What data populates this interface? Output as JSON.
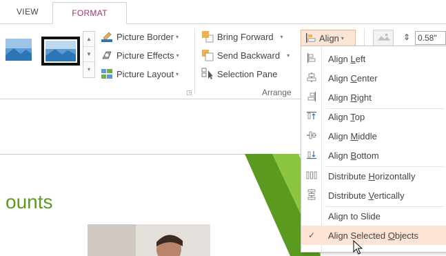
{
  "tabs": {
    "view": "VIEW",
    "format": "FORMAT"
  },
  "ribbon": {
    "picture_styles": {
      "picture_border": "Picture Border",
      "picture_effects": "Picture Effects",
      "picture_layout": "Picture Layout"
    },
    "arrange": {
      "bring_forward": "Bring Forward",
      "send_backward": "Send Backward",
      "selection_pane": "Selection Pane",
      "group_label": "Arrange",
      "align_button": "Align"
    },
    "size": {
      "height_value": "0.58\""
    }
  },
  "align_menu": {
    "items": [
      {
        "pre": "Align ",
        "key": "L",
        "post": "eft",
        "icon": "align-left-icon"
      },
      {
        "pre": "Align ",
        "key": "C",
        "post": "enter",
        "icon": "align-center-icon"
      },
      {
        "pre": "Align ",
        "key": "R",
        "post": "ight",
        "icon": "align-right-icon"
      },
      {
        "pre": "Align ",
        "key": "T",
        "post": "op",
        "icon": "align-top-icon"
      },
      {
        "pre": "Align ",
        "key": "M",
        "post": "iddle",
        "icon": "align-middle-icon"
      },
      {
        "pre": "Align ",
        "key": "B",
        "post": "ottom",
        "icon": "align-bottom-icon"
      },
      {
        "pre": "Distribute ",
        "key": "H",
        "post": "orizontally",
        "icon": "distribute-horizontal-icon"
      },
      {
        "pre": "Distribute ",
        "key": "V",
        "post": "ertically",
        "icon": "distribute-vertical-icon"
      },
      {
        "pre": "Align to Slide",
        "key": "",
        "post": "",
        "icon": ""
      },
      {
        "pre": "Align Selected ",
        "key": "O",
        "post": "bjects",
        "icon": "checkmark-icon"
      }
    ]
  },
  "slide": {
    "title_fragment": "ounts"
  },
  "colors": {
    "format_tab": "#a2306f",
    "accent_green": "#5a9a1e",
    "menu_hover": "#fde4d4"
  }
}
